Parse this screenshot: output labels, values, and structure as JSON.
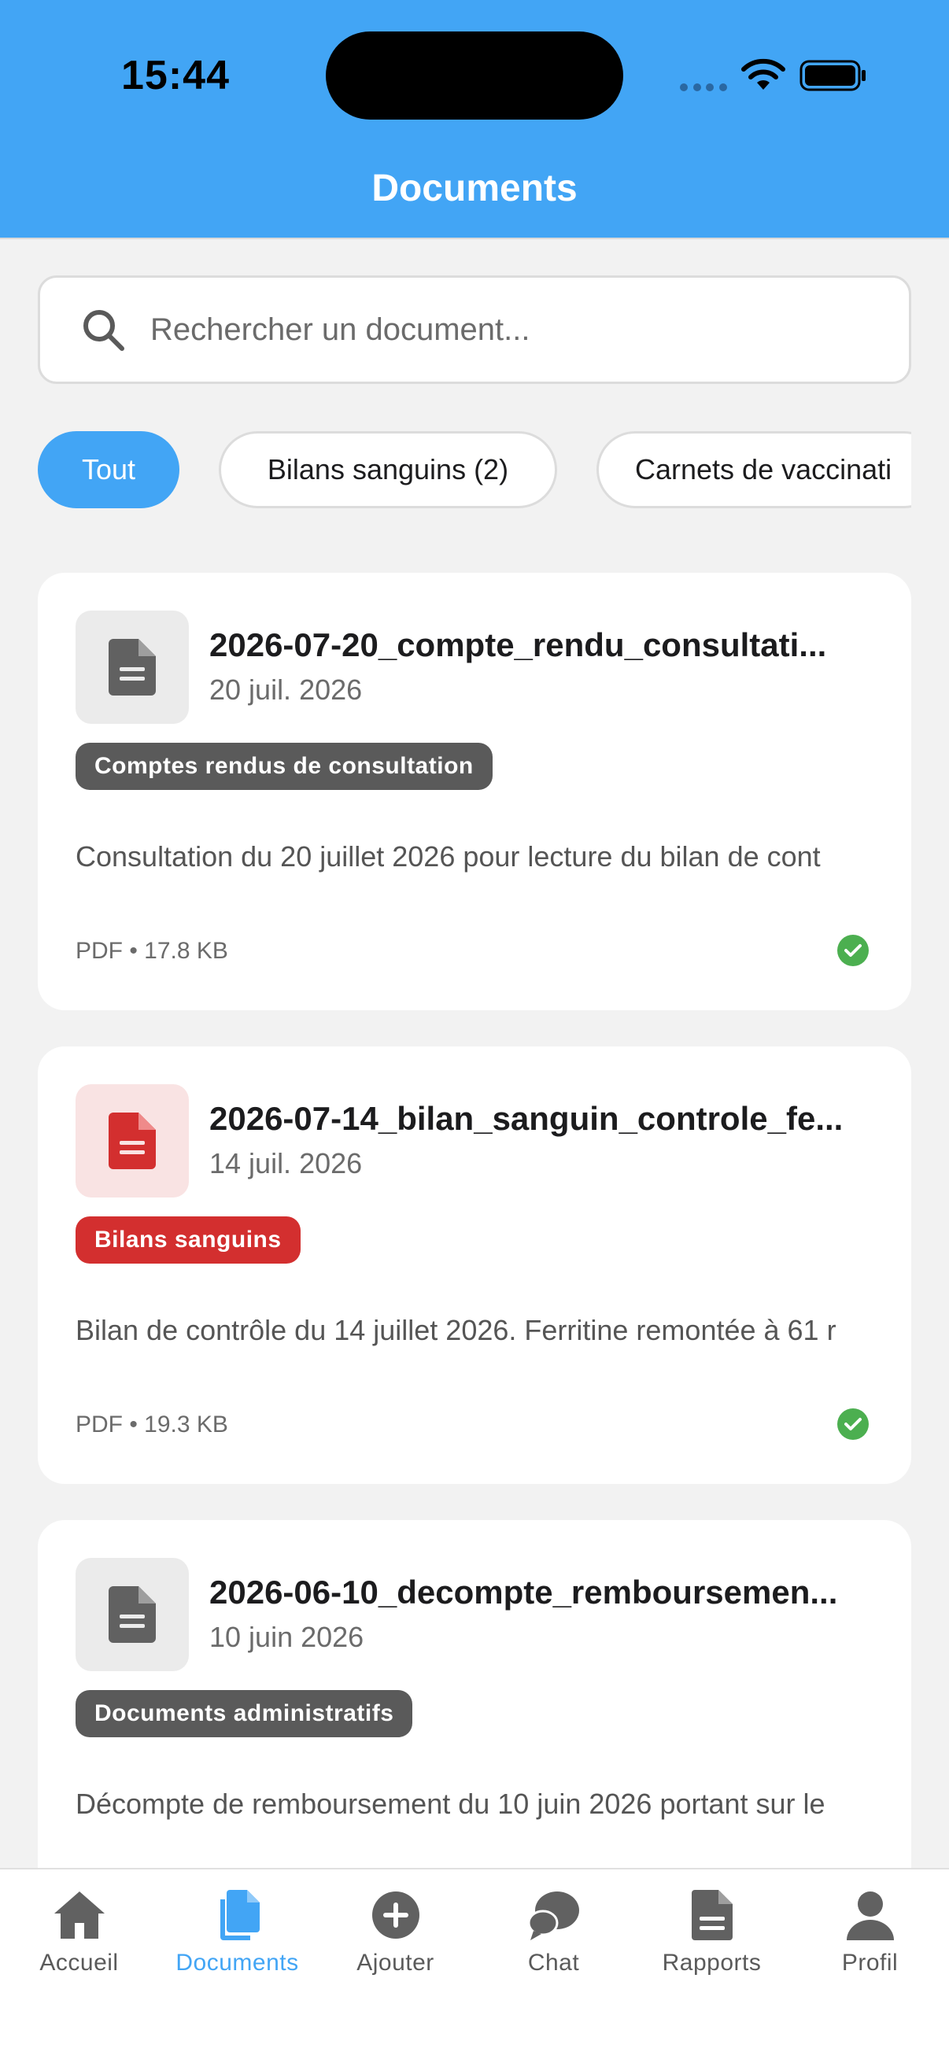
{
  "status_bar": {
    "time": "15:44"
  },
  "header": {
    "title": "Documents"
  },
  "search": {
    "placeholder": "Rechercher un document..."
  },
  "filters": [
    {
      "label": "Tout",
      "active": true
    },
    {
      "label": "Bilans sanguins (2)",
      "active": false
    },
    {
      "label": "Carnets de vaccinati",
      "active": false
    }
  ],
  "documents": [
    {
      "title": "2026-07-20_compte_rendu_consultati...",
      "date": "20 juil. 2026",
      "category": "Comptes rendus de consultation",
      "category_color": "#5a5a5a",
      "icon": "document-icon",
      "icon_color": "#616161",
      "tile_color": "#ebebeb",
      "description": "Consultation du 20 juillet 2026 pour lecture du bilan de cont",
      "meta": "PDF • 17.8 KB",
      "status_icon": "check-circle-icon"
    },
    {
      "title": "2026-07-14_bilan_sanguin_controle_fe...",
      "date": "14 juil. 2026",
      "category": "Bilans sanguins",
      "category_color": "#d32f2f",
      "icon": "document-icon",
      "icon_color": "#d32f2f",
      "tile_color": "#f9e3e3",
      "description": "Bilan de contrôle du 14 juillet 2026. Ferritine remontée à 61 r",
      "meta": "PDF • 19.3 KB",
      "status_icon": "check-circle-icon"
    },
    {
      "title": "2026-06-10_decompte_remboursemen...",
      "date": "10 juin 2026",
      "category": "Documents administratifs",
      "category_color": "#5a5a5a",
      "icon": "document-icon",
      "icon_color": "#616161",
      "tile_color": "#ebebeb",
      "description": "Décompte de remboursement du 10 juin 2026 portant sur le",
      "meta": "",
      "status_icon": ""
    }
  ],
  "bottom_nav": [
    {
      "label": "Accueil",
      "icon": "home-icon",
      "active": false
    },
    {
      "label": "Documents",
      "icon": "documents-icon",
      "active": true
    },
    {
      "label": "Ajouter",
      "icon": "add-circle-icon",
      "active": false
    },
    {
      "label": "Chat",
      "icon": "chat-icon",
      "active": false
    },
    {
      "label": "Rapports",
      "icon": "report-icon",
      "active": false
    },
    {
      "label": "Profil",
      "icon": "profile-icon",
      "active": false
    }
  ],
  "colors": {
    "accent": "#42a5f5",
    "success": "#4caf50",
    "background": "#f2f2f2"
  }
}
